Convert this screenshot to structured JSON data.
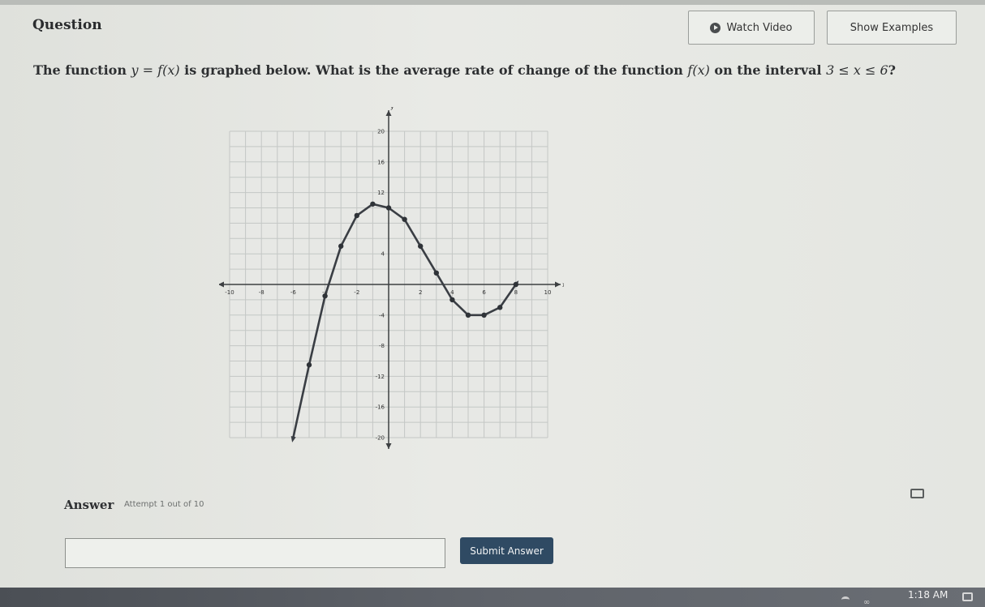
{
  "header": {
    "title": "Question",
    "watch_video_label": "Watch Video",
    "show_examples_label": "Show Examples"
  },
  "question": {
    "part1": "The function ",
    "eq1": "y = f(x)",
    "part2": " is graphed below. What is the average rate of change of the function ",
    "eq2": "f(x)",
    "part3": " on the interval ",
    "eq3": "3 ≤ x ≤ 6",
    "part4": "?"
  },
  "chart_data": {
    "type": "line",
    "title": "",
    "xlabel": "x",
    "ylabel": "y",
    "xlim": [
      -10,
      10
    ],
    "ylim": [
      -20,
      20
    ],
    "x_ticks": [
      -10,
      -8,
      -6,
      -4,
      -2,
      2,
      4,
      6,
      8,
      10
    ],
    "x_tick_labels": [
      "-10",
      "-8",
      "-6",
      "-4",
      "-2",
      "2",
      "4",
      "6",
      "8",
      "10"
    ],
    "y_ticks": [
      -20,
      -16,
      -12,
      -8,
      -4,
      4,
      12,
      16,
      20
    ],
    "y_tick_labels": [
      "-20",
      "-16",
      "-12",
      "-8",
      "-4",
      "4",
      "12",
      "16",
      "20"
    ],
    "grid": true,
    "series": [
      {
        "x": [
          -6,
          -5,
          -4,
          -3,
          -2,
          -1,
          0,
          1,
          2,
          3,
          4,
          5,
          6,
          7,
          8
        ],
        "y": [
          -20,
          -10.5,
          -1.5,
          5,
          9,
          10.5,
          10,
          8.5,
          5,
          1.5,
          -2,
          -4,
          -4,
          -3,
          0
        ]
      }
    ],
    "marked_points": {
      "x": [
        -5,
        -4,
        -3,
        -2,
        -1,
        0,
        1,
        2,
        3,
        4,
        5,
        6,
        7,
        8
      ],
      "y": [
        -10.5,
        -1.5,
        5,
        9,
        10.5,
        10,
        8.5,
        5,
        1.5,
        -2,
        -4,
        -4,
        -3,
        0
      ]
    }
  },
  "answer": {
    "label": "Answer",
    "attempt_text": "Attempt 1 out of 10",
    "input_value": "",
    "submit_label": "Submit Answer"
  },
  "taskbar": {
    "time": "1:18 AM"
  }
}
